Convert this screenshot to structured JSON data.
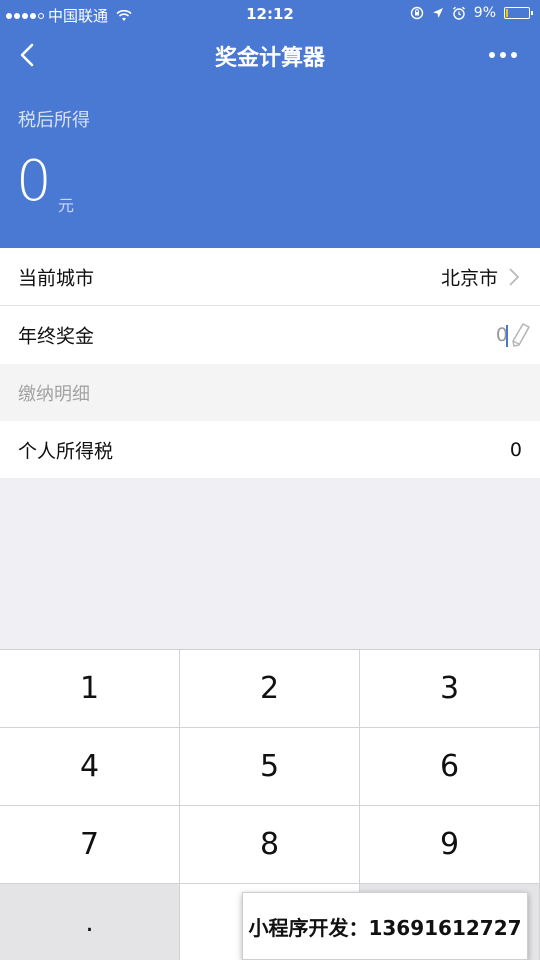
{
  "status_bar": {
    "carrier": "中国联通",
    "time": "12:12",
    "battery_percent": "9%",
    "battery_level": 0.09,
    "signal_bars_filled": 4,
    "signal_bars_total": 5
  },
  "nav": {
    "title": "奖金计算器"
  },
  "summary": {
    "label": "税后所得",
    "value": "0",
    "unit": "元"
  },
  "city_row": {
    "label": "当前城市",
    "value": "北京市"
  },
  "bonus_row": {
    "label": "年终奖金",
    "input_value": "0"
  },
  "section": {
    "title": "缴纳明细"
  },
  "tax_row": {
    "label": "个人所得税",
    "value": "0"
  },
  "keypad": {
    "keys": [
      "1",
      "2",
      "3",
      "4",
      "5",
      "6",
      "7",
      "8",
      "9",
      "."
    ]
  },
  "watermark": {
    "text": "小程序开发：13691612727"
  },
  "colors": {
    "header": "#4a79d4",
    "background": "#efeff4",
    "key_gray": "#e4e4e7"
  }
}
